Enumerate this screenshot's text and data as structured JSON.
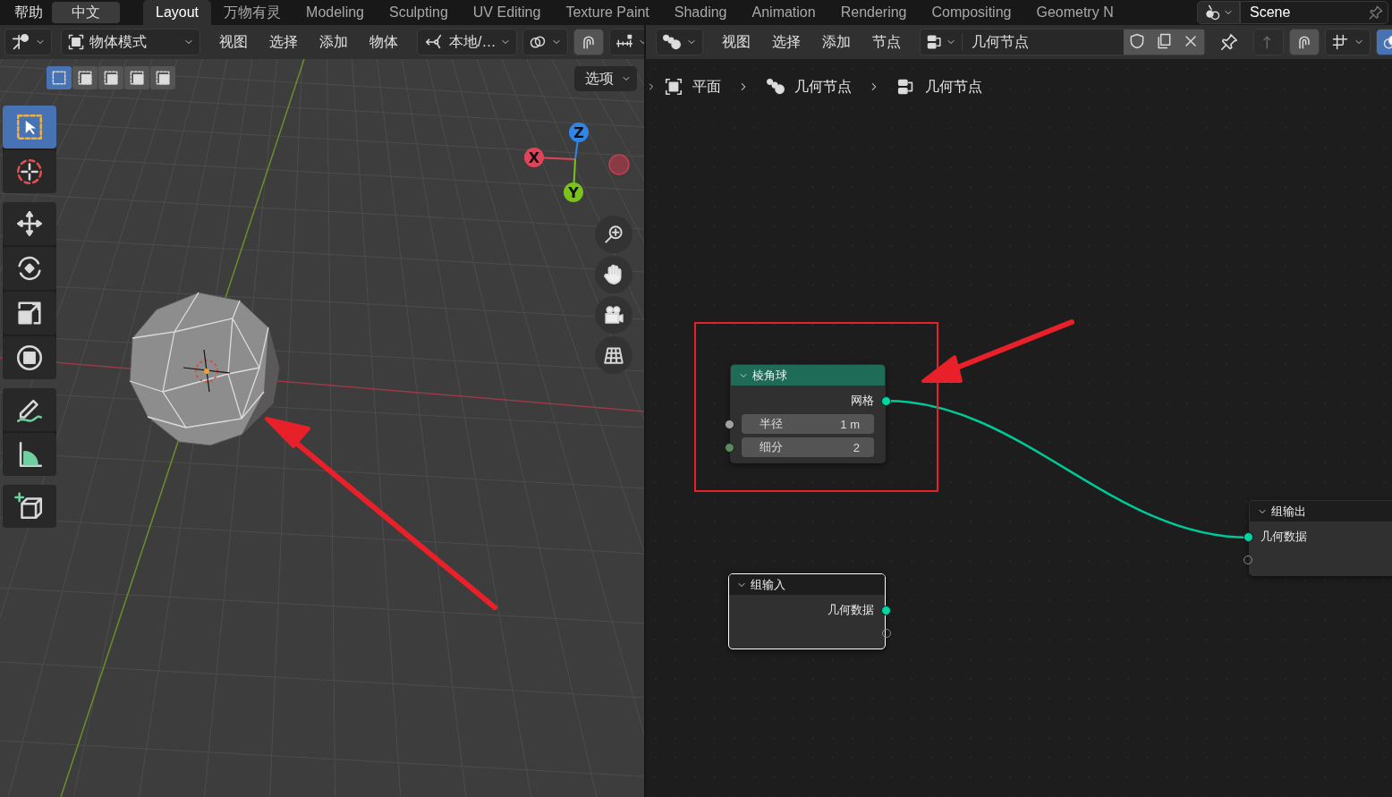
{
  "topbar": {
    "menus": [
      "帮助",
      "中文"
    ],
    "workspaces": [
      {
        "label": "Layout",
        "selected": true
      },
      {
        "label": "万物有灵",
        "selected": false
      },
      {
        "label": "Modeling",
        "selected": false
      },
      {
        "label": "Sculpting",
        "selected": false
      },
      {
        "label": "UV Editing",
        "selected": false
      },
      {
        "label": "Texture Paint",
        "selected": false
      },
      {
        "label": "Shading",
        "selected": false
      },
      {
        "label": "Animation",
        "selected": false
      },
      {
        "label": "Rendering",
        "selected": false
      },
      {
        "label": "Compositing",
        "selected": false
      },
      {
        "label": "Geometry N",
        "selected": false
      }
    ],
    "scene": "Scene"
  },
  "viewport": {
    "header": {
      "mode": "物体模式",
      "menus": [
        "视图",
        "选择",
        "添加",
        "物体"
      ],
      "orientation": "本地/…",
      "snapping_on": true
    },
    "select_modes": [
      {
        "selected": true
      },
      {
        "selected": false
      },
      {
        "selected": false
      },
      {
        "selected": false
      },
      {
        "selected": false
      }
    ],
    "options": "选项",
    "tool_groups": [
      {
        "tools": [
          {
            "kind": "select",
            "selected": true
          },
          {
            "kind": "cursor",
            "selected": false
          }
        ]
      },
      {
        "tools": [
          {
            "kind": "move",
            "selected": false
          },
          {
            "kind": "rotate",
            "selected": false
          },
          {
            "kind": "scale",
            "selected": false
          },
          {
            "kind": "transform",
            "selected": false
          }
        ]
      },
      {
        "tools": [
          {
            "kind": "annotate",
            "selected": false
          },
          {
            "kind": "measure",
            "selected": false
          }
        ]
      },
      {
        "tools": [
          {
            "kind": "add_cube",
            "selected": false
          }
        ]
      }
    ],
    "gizmo": {
      "axes": [
        {
          "label": "Z"
        },
        {
          "label": "X"
        },
        {
          "label": "Y"
        }
      ]
    }
  },
  "node_editor": {
    "header": {
      "menus": [
        "视图",
        "选择",
        "添加",
        "节点"
      ],
      "node_group": "几何节点",
      "snapping_on": true,
      "overlays_on": true
    },
    "breadcrumbs": [
      "平面",
      "几何节点",
      "几何节点"
    ],
    "nodes": [
      {
        "kind": "geometry",
        "title": "棱角球",
        "selected": false,
        "rows": [
          {
            "kind": "output",
            "label": "网格",
            "socket": {
              "kind": "geometry"
            }
          },
          {
            "kind": "field",
            "label": "半径",
            "value": "1 m",
            "socket": {
              "kind": "float"
            }
          },
          {
            "kind": "field",
            "label": "细分",
            "value": "2",
            "socket": {
              "kind": "integer"
            }
          }
        ]
      },
      {
        "kind": "group",
        "title": "组输出",
        "selected": false,
        "rows": [
          {
            "kind": "input",
            "label": "几何数据",
            "socket": {
              "kind": "geometry"
            }
          },
          {
            "kind": "input",
            "socket": {
              "kind": "virtual"
            }
          }
        ]
      },
      {
        "kind": "group",
        "title": "组输入",
        "selected": true,
        "rows": [
          {
            "kind": "output",
            "label": "几何数据",
            "socket": {
              "kind": "geometry"
            }
          },
          {
            "kind": "output",
            "socket": {
              "kind": "virtual"
            }
          }
        ]
      }
    ]
  }
}
